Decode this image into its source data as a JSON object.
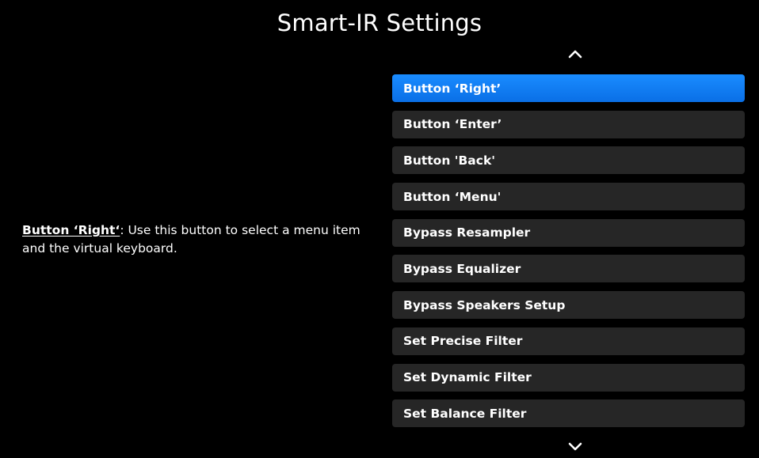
{
  "header": {
    "title": "Smart-IR Settings"
  },
  "colors": {
    "background": "#000000",
    "item_background": "#262626",
    "selected_background": "#0a7cf5",
    "text": "#ffffff"
  },
  "icons": {
    "scroll_up": "chevron-up-icon",
    "scroll_down": "chevron-down-icon"
  },
  "description": {
    "term": "Button ‘Right‘",
    "text": ": Use this button to select a menu item and the virtual keyboard."
  },
  "menu": {
    "selected_index": 0,
    "items": [
      {
        "label": "Button ‘Right’"
      },
      {
        "label": "Button ‘Enter’"
      },
      {
        "label": "Button 'Back'"
      },
      {
        "label": "Button ‘Menu'"
      },
      {
        "label": "Bypass Resampler"
      },
      {
        "label": "Bypass Equalizer"
      },
      {
        "label": "Bypass Speakers Setup"
      },
      {
        "label": "Set Precise Filter"
      },
      {
        "label": "Set Dynamic Filter"
      },
      {
        "label": "Set Balance Filter"
      }
    ]
  }
}
